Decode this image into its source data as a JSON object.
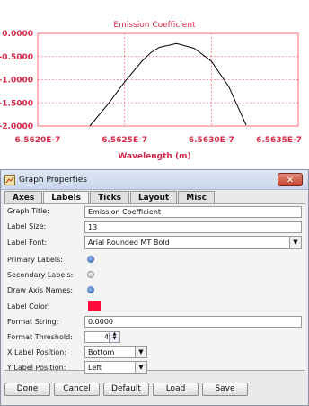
{
  "chart_data": {
    "type": "line",
    "title": "Emission Coefficient",
    "xlabel": "Wavelength (m)",
    "ylabel": "",
    "xlim": [
      6.562e-07,
      6.5635e-07
    ],
    "ylim": [
      -2.0,
      0.0
    ],
    "x_ticks": [
      "6.5620E-7",
      "6.5625E-7",
      "6.5630E-7",
      "6.5635E-7"
    ],
    "y_ticks": [
      "0.0000",
      "-0.5000",
      "-1.0000",
      "-1.5000",
      "-2.0000"
    ],
    "grid": true,
    "colors": {
      "frame": "#ff6a7a",
      "grid": "#ff4d64",
      "title": "#d42a4a",
      "line": "#000000"
    },
    "series": [
      {
        "x": [
          6.5623e-07,
          6.5624e-07,
          6.5625e-07,
          6.5626e-07,
          6.56265e-07,
          6.5627e-07,
          6.5628e-07,
          6.5629e-07,
          6.563e-07,
          6.5631e-07,
          6.5632e-07
        ],
        "y": [
          -2.0,
          -1.55,
          -1.05,
          -0.6,
          -0.42,
          -0.3,
          -0.22,
          -0.32,
          -0.6,
          -1.15,
          -1.98
        ]
      }
    ]
  },
  "dialog": {
    "title": "Graph Properties",
    "close": "✕",
    "tabs": [
      "Axes",
      "Labels",
      "Ticks",
      "Layout",
      "Misc"
    ],
    "active_tab": "Labels",
    "fields": {
      "graph_title_label": "Graph Title:",
      "graph_title_value": "Emission Coefficient",
      "label_size_label": "Label Size:",
      "label_size_value": "13",
      "label_font_label": "Label Font:",
      "label_font_value": "Arial Rounded MT Bold",
      "primary_labels_label": "Primary Labels:",
      "primary_labels_checked": true,
      "secondary_labels_label": "Secondary Labels:",
      "secondary_labels_checked": false,
      "draw_axis_names_label": "Draw Axis Names:",
      "draw_axis_names_checked": true,
      "label_color_label": "Label Color:",
      "label_color_value": "#ff0a3c",
      "format_string_label": "Format String:",
      "format_string_value": "0.0000",
      "format_threshold_label": "Format Threshold:",
      "format_threshold_value": "4",
      "x_label_position_label": "X Label Position:",
      "x_label_position_value": "Bottom",
      "y_label_position_label": "Y Label Position:",
      "y_label_position_value": "Left"
    },
    "buttons": [
      "Done",
      "Cancel",
      "Default",
      "Load",
      "Save"
    ]
  }
}
